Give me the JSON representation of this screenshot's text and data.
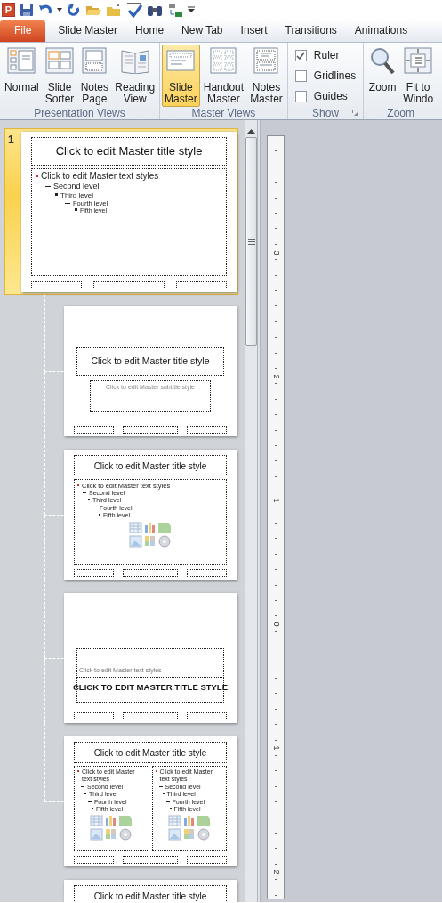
{
  "quick_access": {
    "app_icon": "P"
  },
  "tabs": [
    {
      "label": "File",
      "kind": "file",
      "selected": false
    },
    {
      "label": "Slide Master",
      "kind": "tab",
      "selected": false
    },
    {
      "label": "Home",
      "kind": "tab",
      "selected": false
    },
    {
      "label": "New Tab",
      "kind": "tab",
      "selected": false
    },
    {
      "label": "Insert",
      "kind": "tab",
      "selected": false
    },
    {
      "label": "Transitions",
      "kind": "tab",
      "selected": false
    },
    {
      "label": "Animations",
      "kind": "tab",
      "selected": false
    }
  ],
  "ribbon": {
    "groups": [
      {
        "label": "Presentation Views",
        "kind": "buttons",
        "items": [
          {
            "label": "Normal",
            "kind": "normal",
            "selected": false
          },
          {
            "label": "Slide\nSorter",
            "kind": "sorter",
            "selected": false
          },
          {
            "label": "Notes\nPage",
            "kind": "notes_page",
            "selected": false
          },
          {
            "label": "Reading\nView",
            "kind": "reading",
            "selected": false
          }
        ]
      },
      {
        "label": "Master Views",
        "kind": "buttons",
        "items": [
          {
            "label": "Slide\nMaster",
            "kind": "slide_master",
            "selected": true
          },
          {
            "label": "Handout\nMaster",
            "kind": "handout",
            "selected": false
          },
          {
            "label": "Notes\nMaster",
            "kind": "notes_master",
            "selected": false
          }
        ]
      },
      {
        "label": "Show",
        "kind": "checks",
        "items": [
          {
            "label": "Ruler",
            "checked": true
          },
          {
            "label": "Gridlines",
            "checked": false
          },
          {
            "label": "Guides",
            "checked": false
          }
        ]
      },
      {
        "label": "Zoom",
        "kind": "buttons",
        "items": [
          {
            "label": "Zoom",
            "kind": "zoom",
            "selected": false
          },
          {
            "label": "Fit to\nWindo",
            "kind": "fit",
            "selected": false
          }
        ]
      }
    ]
  },
  "slides": [
    {
      "number": "1",
      "kind": "master",
      "selected": true,
      "title": "Click to edit Master title style",
      "levels": [
        {
          "text": "Click to edit Master text styles",
          "children": [
            {
              "text": "Second level",
              "children": [
                {
                  "text": "Third level",
                  "children": [
                    {
                      "text": "Fourth level",
                      "children": [
                        {
                          "text": "Fifth level"
                        }
                      ]
                    }
                  ]
                }
              ]
            }
          ]
        }
      ]
    },
    {
      "kind": "title",
      "selected": false,
      "title": "Click to edit Master title style",
      "subtitle": "Click to edit Master subtitle style"
    },
    {
      "kind": "content",
      "selected": false,
      "title": "Click to edit Master title style",
      "columns": [
        {
          "levels": [
            {
              "text": "Click to edit Master text styles",
              "children": [
                {
                  "text": "Second level",
                  "children": [
                    {
                      "text": "Third level",
                      "children": [
                        {
                          "text": "Fourth level",
                          "children": [
                            {
                              "text": "Fifth level"
                            }
                          ]
                        }
                      ]
                    }
                  ]
                }
              ]
            }
          ]
        }
      ]
    },
    {
      "kind": "section",
      "selected": false,
      "text": "Click to edit Master text styles",
      "title": "CLICK TO EDIT MASTER TITLE STYLE"
    },
    {
      "kind": "content",
      "selected": false,
      "title": "Click to edit Master title style",
      "columns": [
        {
          "levels": [
            {
              "text": "Click to edit Master text styles",
              "children": [
                {
                  "text": "Second level",
                  "children": [
                    {
                      "text": "Third level",
                      "children": [
                        {
                          "text": "Fourth level",
                          "children": [
                            {
                              "text": "Fifth level"
                            }
                          ]
                        }
                      ]
                    }
                  ]
                }
              ]
            }
          ]
        },
        {
          "levels": [
            {
              "text": "Click to edit Master text styles",
              "children": [
                {
                  "text": "Second level",
                  "children": [
                    {
                      "text": "Third level",
                      "children": [
                        {
                          "text": "Fourth level",
                          "children": [
                            {
                              "text": "Fifth level"
                            }
                          ]
                        }
                      ]
                    }
                  ]
                }
              ]
            }
          ]
        }
      ]
    },
    {
      "kind": "title_only",
      "selected": false,
      "title": "Click to edit Master title style"
    }
  ],
  "ruler": {
    "labels": [
      "3",
      "2",
      "1",
      "0",
      "1",
      "2"
    ]
  }
}
